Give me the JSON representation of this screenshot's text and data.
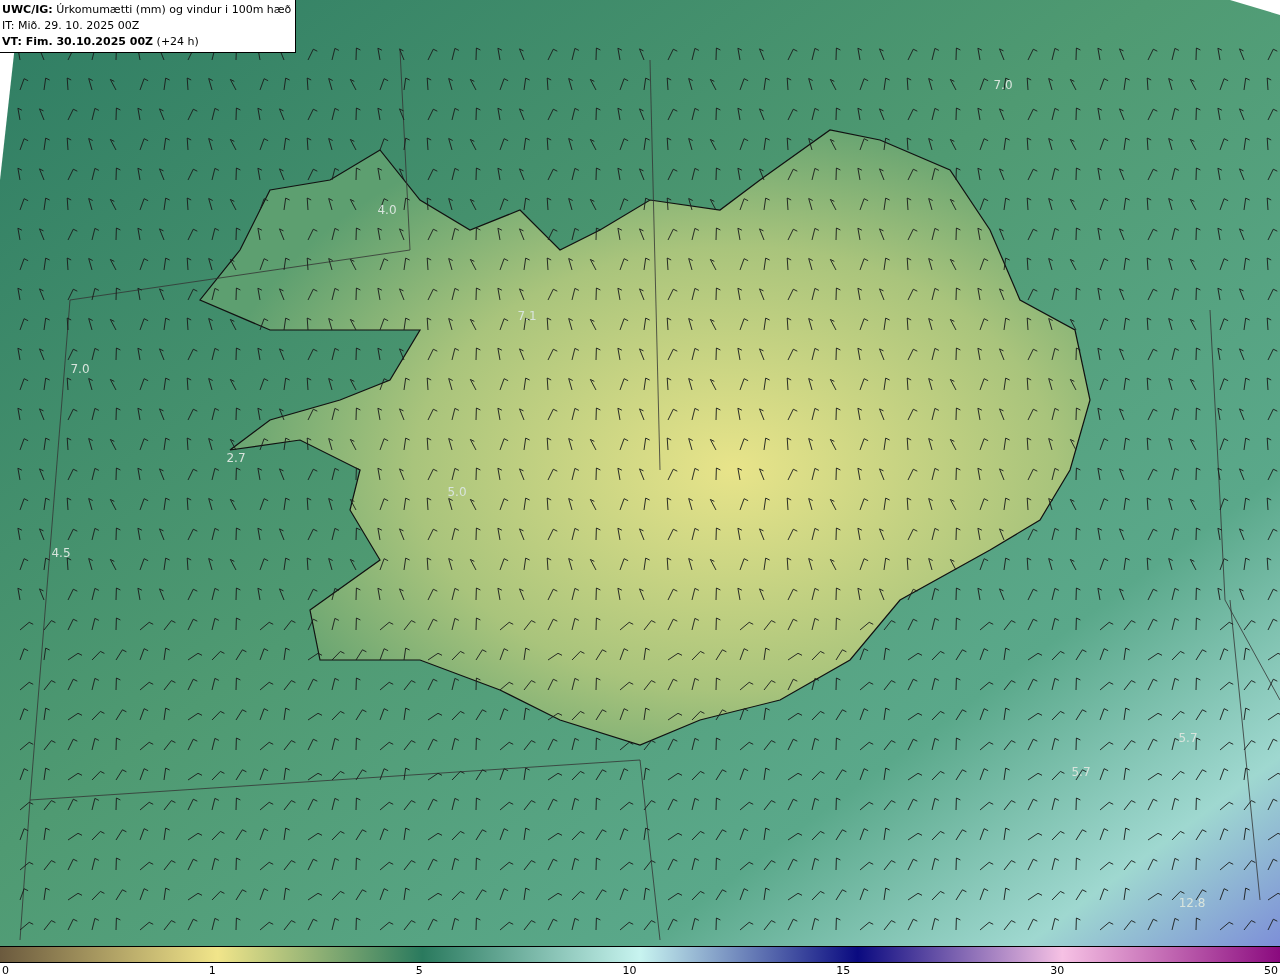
{
  "legend": {
    "lines": [
      "**UWC/IG:** Úrkomumætti (mm) og vindur i 100m hæð",
      "IT: Mið. 29. 10. 2025 00Z",
      "**VT: Fim. 30.10.2025 00Z** (+24 h)"
    ]
  },
  "map": {
    "value_labels": [
      "7.0",
      "4.0",
      "7.1",
      "7.0",
      "2.7",
      "5.0",
      "4.5",
      "5.7",
      "5.7",
      "12.8"
    ]
  },
  "colorbar": {
    "ticks": [
      "0",
      "1",
      "5",
      "10",
      "15",
      "30",
      "50"
    ]
  }
}
